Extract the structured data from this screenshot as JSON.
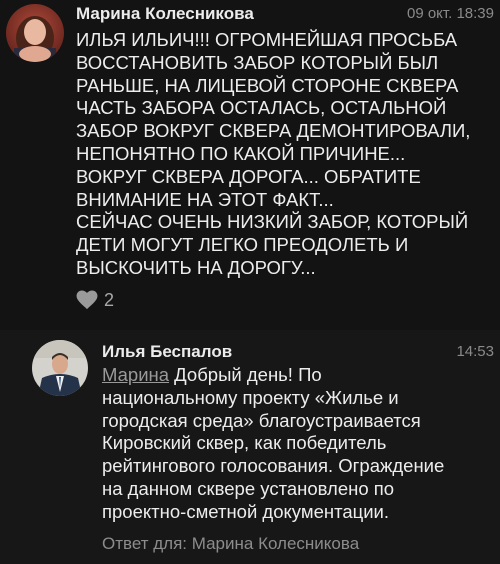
{
  "comments": [
    {
      "author": "Марина Колесникова",
      "time": "09 окт. 18:39",
      "lines": [
        "ИЛЬЯ ИЛЬИЧ!!! ОГРОМНЕЙШАЯ ПРОСЬБА",
        "ВОССТАНОВИТЬ ЗАБОР КОТОРЫЙ БЫЛ",
        "РАНЬШЕ, НА ЛИЦЕВОЙ СТОРОНЕ СКВЕРА",
        "ЧАСТЬ ЗАБОРА ОСТАЛАСЬ, ОСТАЛЬНОЙ",
        "ЗАБОР ВОКРУГ СКВЕРА ДЕМОНТИРОВАЛИ,",
        "НЕПОНЯТНО ПО КАКОЙ ПРИЧИНЕ...",
        "ВОКРУГ СКВЕРА ДОРОГА... ОБРАТИТЕ",
        "ВНИМАНИЕ НА ЭТОТ ФАКТ...",
        "СЕЙЧАС ОЧЕНЬ НИЗКИЙ ЗАБОР, КОТОРЫЙ",
        "ДЕТИ МОГУТ ЛЕГКО ПРЕОДОЛЕТЬ И",
        "ВЫСКОЧИТЬ НА ДОРОГУ..."
      ],
      "likes": "2",
      "like_icon": "heart-icon"
    },
    {
      "author": "Илья Беспалов",
      "time": "14:53",
      "mention": "Марина",
      "first_line_rest": " Добрый день! По",
      "lines": [
        "национальному проекту «Жилье и",
        "городская среда» благоустраивается",
        "Кировский сквер, как победитель",
        "рейтингового голосования. Ограждение",
        "на данном сквере установлено по",
        "проектно-сметной документации."
      ],
      "reply_to": "Ответ для: Марина Колесникова"
    }
  ],
  "colors": {
    "background": "#131313",
    "text": "#ededed",
    "muted": "#8a8a8a"
  }
}
